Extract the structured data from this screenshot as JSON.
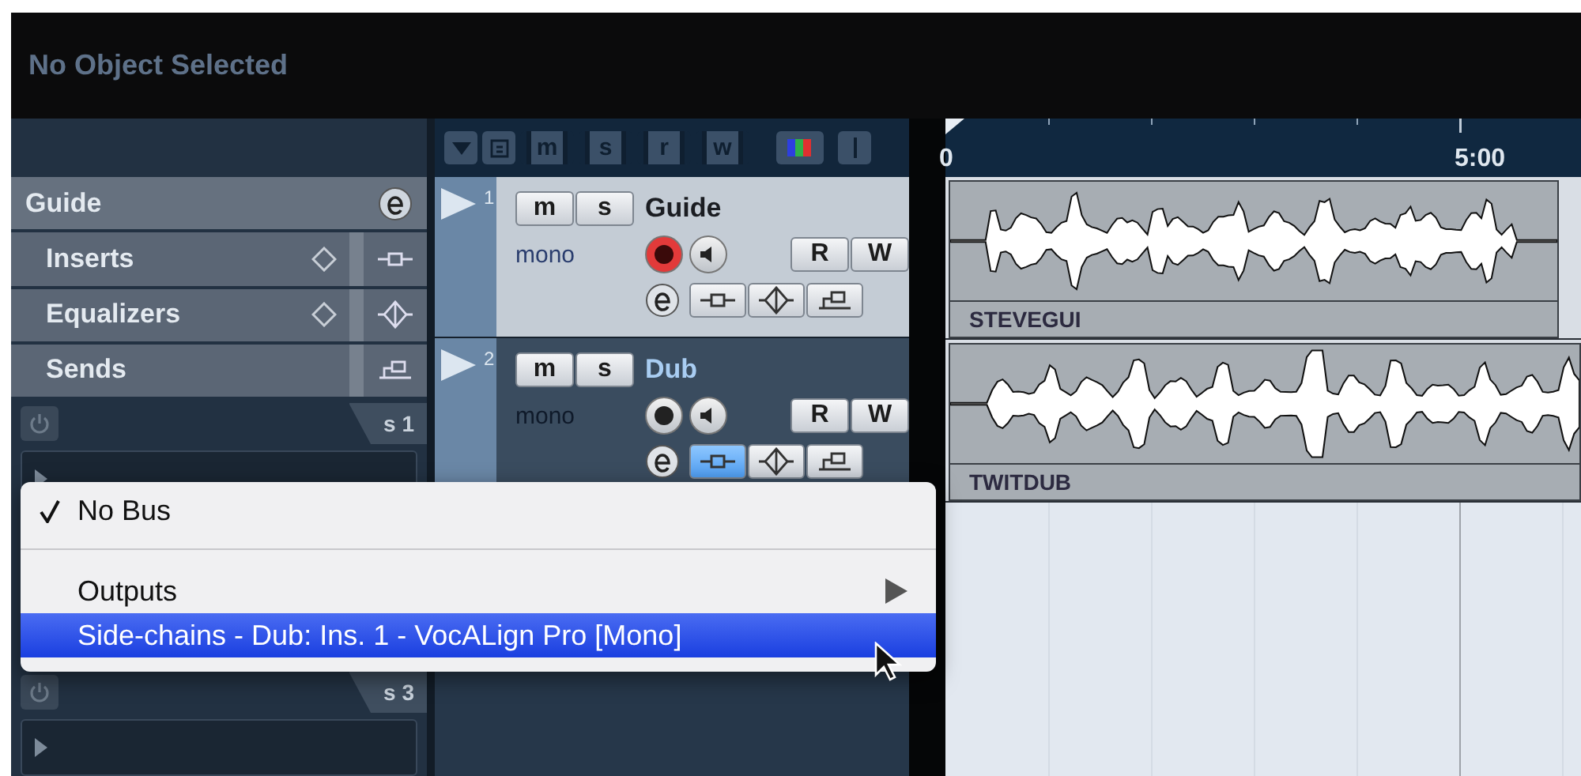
{
  "header": {
    "title": "No Object Selected"
  },
  "inspector": {
    "sections": [
      {
        "kind": "track",
        "label": "Guide"
      },
      {
        "kind": "inserts",
        "label": "Inserts"
      },
      {
        "kind": "equalizers",
        "label": "Equalizers"
      },
      {
        "kind": "sends",
        "label": "Sends"
      }
    ],
    "send_slots": [
      {
        "label": "s 1"
      },
      {
        "label": "s 3"
      }
    ]
  },
  "toolbar": {
    "buttons": [
      "m",
      "s",
      "r",
      "w"
    ]
  },
  "tracks": [
    {
      "number": "1",
      "name": "Guide",
      "selected": true,
      "mute": "m",
      "solo": "s",
      "channel": "mono",
      "record_armed": true,
      "read": "R",
      "write": "W",
      "inserts_active": false
    },
    {
      "number": "2",
      "name": "Dub",
      "selected": false,
      "mute": "m",
      "solo": "s",
      "channel": "mono",
      "record_armed": false,
      "read": "R",
      "write": "W",
      "inserts_active": true
    }
  ],
  "ruler": {
    "labels": [
      "0",
      "5:00"
    ]
  },
  "clips": [
    {
      "name": "STEVEGUI"
    },
    {
      "name": "TWITDUB"
    }
  ],
  "menu": {
    "items": [
      {
        "kind": "item",
        "label": "No Bus",
        "checked": true,
        "selected": false,
        "submenu": false
      },
      {
        "kind": "separator"
      },
      {
        "kind": "item",
        "label": "Outputs",
        "checked": false,
        "selected": false,
        "submenu": true
      },
      {
        "kind": "item",
        "label": "Side-chains - Dub: Ins. 1 - VocALign Pro [Mono]",
        "checked": false,
        "selected": true,
        "submenu": false
      }
    ]
  }
}
